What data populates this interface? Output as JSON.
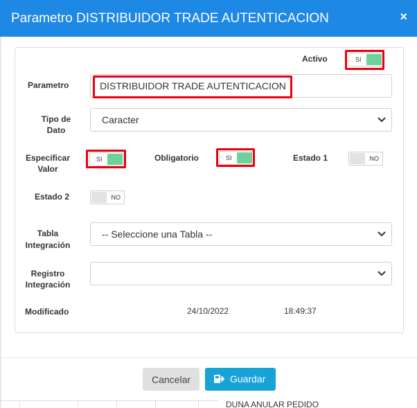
{
  "modal": {
    "title": "Parametro DISTRIBUIDOR TRADE AUTENTICACION",
    "close_label": "×"
  },
  "form": {
    "activo_label": "Activo",
    "parametro_label": "Parametro",
    "parametro_value": "DISTRIBUIDOR TRADE AUTENTICACION",
    "tipo_dato_label_1": "Tipo de",
    "tipo_dato_label_2": "Dato",
    "tipo_dato_value": "Caracter",
    "especificar_label_1": "Especificar",
    "especificar_label_2": "Valor",
    "obligatorio_label": "Obligatorio",
    "estado1_label": "Estado 1",
    "estado2_label": "Estado 2",
    "tabla_label_1": "Tabla",
    "tabla_label_2": "Integración",
    "tabla_value": "-- Seleccione una Tabla --",
    "registro_label_1": "Registro",
    "registro_label_2": "Integración",
    "registro_value": "",
    "modificado_label": "Modificado",
    "modificado_date": "24/10/2022",
    "modificado_time": "18:49:37",
    "toggle_on_text": "SI",
    "toggle_off_text": "NO",
    "toggles": {
      "activo": true,
      "especificar_valor": true,
      "obligatorio": true,
      "estado1": false,
      "estado2": false
    }
  },
  "footer": {
    "cancel_label": "Cancelar",
    "save_label": "Guardar"
  },
  "background": {
    "row_text": "DUNA ANULAR PEDIDO"
  },
  "colors": {
    "header": "#1e88e5",
    "toggle_on": "#6cd19a",
    "highlight": "#e8000d",
    "save_button": "#17a2d8"
  }
}
